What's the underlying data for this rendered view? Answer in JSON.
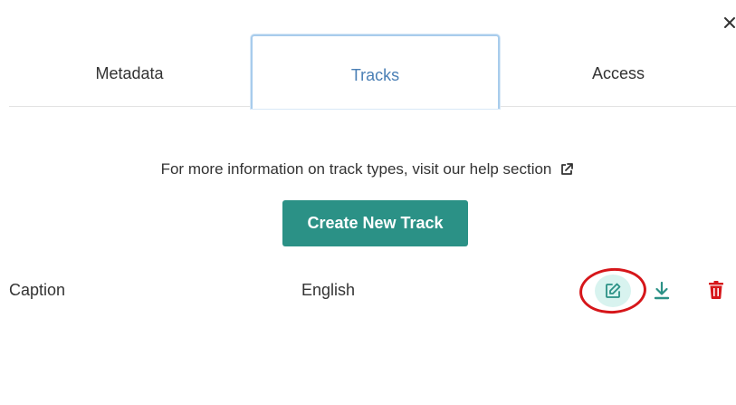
{
  "tabs": [
    {
      "label": "Metadata",
      "active": false
    },
    {
      "label": "Tracks",
      "active": true
    },
    {
      "label": "Access",
      "active": false
    }
  ],
  "info": {
    "text": "For more information on track types, visit our help section",
    "icon": "external-link-icon"
  },
  "create_button": {
    "label": "Create New Track"
  },
  "tracks": [
    {
      "type": "Caption",
      "language": "English"
    }
  ],
  "icons": {
    "close": "close-icon",
    "edit": "edit-icon",
    "download": "download-icon",
    "delete": "trash-icon"
  },
  "colors": {
    "accent": "#2b9186",
    "active_tab_border": "#a8ccec",
    "active_tab_text": "#4a7fb5",
    "delete": "#d6161a",
    "edit_bg": "#d8f3ef",
    "highlight": "#d6161a"
  }
}
